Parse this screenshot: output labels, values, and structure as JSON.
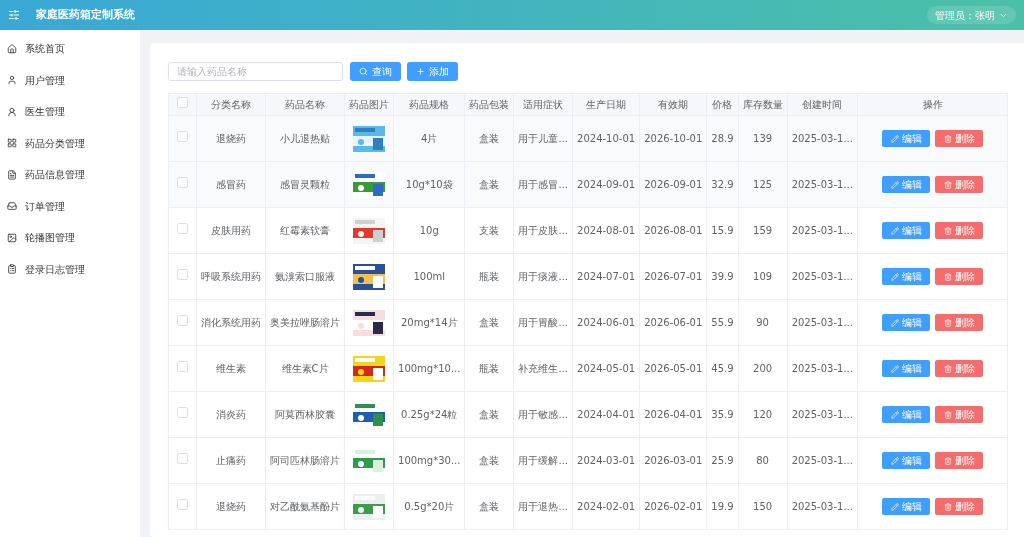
{
  "header": {
    "title": "家庭医药箱定制系统",
    "user": "管理员：张明"
  },
  "sidebar": {
    "items": [
      {
        "label": "系统首页",
        "selected": false
      },
      {
        "label": "用户管理",
        "selected": false
      },
      {
        "label": "医生管理",
        "selected": false
      },
      {
        "label": "药品分类管理",
        "selected": false
      },
      {
        "label": "药品信息管理",
        "selected": false
      },
      {
        "label": "订单管理",
        "selected": false
      },
      {
        "label": "轮播图管理",
        "selected": false
      },
      {
        "label": "登录日志管理",
        "selected": false
      }
    ]
  },
  "search": {
    "placeholder": "请输入药品名称",
    "buttons": [
      "查询",
      "添加"
    ]
  },
  "table": {
    "columns": [
      "分类名称",
      "药品名称",
      "药品图片",
      "药品规格",
      "药品包装",
      "适用症状",
      "生产日期",
      "有效期",
      "价格",
      "库存数量",
      "创建时间",
      "操作"
    ],
    "header_checked": false,
    "rows": [
      {
        "checked": false,
        "cells": [
          "退烧药",
          "小儿退热贴",
          {
            "kind": "picture"
          },
          "4片",
          "盒装",
          "用于儿童...",
          "2024-10-01",
          "2026-10-01",
          "28.9",
          "139",
          "2025-03-1..."
        ],
        "actions": [
          "编辑",
          "删除"
        ]
      },
      {
        "checked": false,
        "cells": [
          "感冒药",
          "感冒灵颗粒",
          {
            "kind": "picture"
          },
          "10g*10袋",
          "盒装",
          "用于感冒...",
          "2024-09-01",
          "2026-09-01",
          "32.9",
          "125",
          "2025-03-1..."
        ],
        "actions": [
          "编辑",
          "删除"
        ]
      },
      {
        "checked": false,
        "cells": [
          "皮肤用药",
          "红霉素软膏",
          {
            "kind": "picture"
          },
          "10g",
          "支装",
          "用于皮肤...",
          "2024-08-01",
          "2026-08-01",
          "15.9",
          "159",
          "2025-03-1..."
        ],
        "actions": [
          "编辑",
          "删除"
        ]
      },
      {
        "checked": false,
        "cells": [
          "呼吸系统用药",
          "氨溴索口服液",
          {
            "kind": "picture"
          },
          "100ml",
          "瓶装",
          "用于痰液...",
          "2024-07-01",
          "2026-07-01",
          "39.9",
          "109",
          "2025-03-1..."
        ],
        "actions": [
          "编辑",
          "删除"
        ]
      },
      {
        "checked": false,
        "cells": [
          "消化系统用药",
          "奥美拉唑肠溶片",
          {
            "kind": "picture"
          },
          "20mg*14片",
          "盒装",
          "用于胃酸...",
          "2024-06-01",
          "2026-06-01",
          "55.9",
          "90",
          "2025-03-1..."
        ],
        "actions": [
          "编辑",
          "删除"
        ]
      },
      {
        "checked": false,
        "cells": [
          "维生素",
          "维生素C片",
          {
            "kind": "picture"
          },
          "100mg*10...",
          "瓶装",
          "补充维生...",
          "2024-05-01",
          "2026-05-01",
          "45.9",
          "200",
          "2025-03-1..."
        ],
        "actions": [
          "编辑",
          "删除"
        ]
      },
      {
        "checked": false,
        "cells": [
          "消炎药",
          "阿莫西林胶囊",
          {
            "kind": "picture"
          },
          "0.25g*24粒",
          "盒装",
          "用于敏感...",
          "2024-04-01",
          "2026-04-01",
          "35.9",
          "120",
          "2025-03-1..."
        ],
        "actions": [
          "编辑",
          "删除"
        ]
      },
      {
        "checked": false,
        "cells": [
          "止痛药",
          "阿司匹林肠溶片",
          {
            "kind": "picture"
          },
          "100mg*30...",
          "盒装",
          "用于缓解...",
          "2024-03-01",
          "2026-03-01",
          "25.9",
          "80",
          "2025-03-1..."
        ],
        "actions": [
          "编辑",
          "删除"
        ]
      },
      {
        "checked": false,
        "cells": [
          "退烧药",
          "对乙酰氨基酚片",
          {
            "kind": "picture"
          },
          "0.5g*20片",
          "盒装",
          "用于退热...",
          "2024-02-01",
          "2026-02-01",
          "19.9",
          "150",
          "2025-03-1..."
        ],
        "actions": [
          "编辑",
          "删除"
        ]
      }
    ]
  }
}
